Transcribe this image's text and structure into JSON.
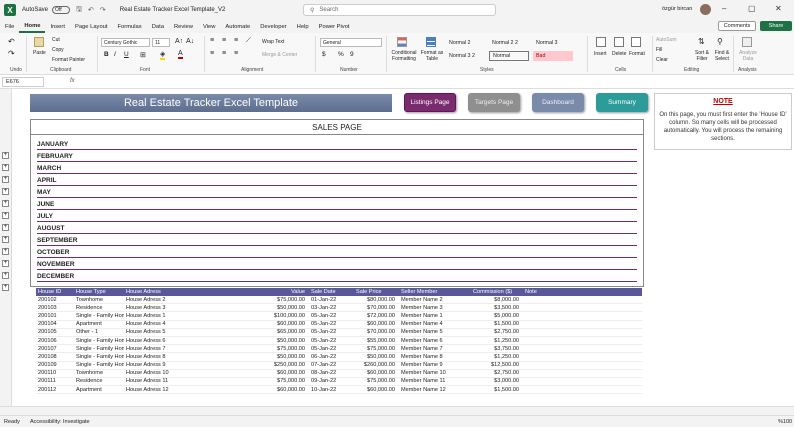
{
  "titlebar": {
    "autosave": "AutoSave",
    "toggle": "Off",
    "doc_title": "Real Estate Tracker Excel Template_V2",
    "search_placeholder": "Search",
    "user": "özgür bircan"
  },
  "menu": [
    "File",
    "Home",
    "Insert",
    "Page Layout",
    "Formulas",
    "Data",
    "Review",
    "View",
    "Automate",
    "Developer",
    "Help",
    "Power Pivot"
  ],
  "comments": "Comments",
  "share": "Share",
  "ribbon": {
    "paste": "Paste",
    "cut": "Cut",
    "copy": "Copy",
    "format_painter": "Format Painter",
    "font_name": "Century Gothic",
    "font_size": "11",
    "wrap_text": "Wrap Text",
    "merge_center": "Merge & Center",
    "number_format": "General",
    "conditional_formatting": "Conditional Formatting",
    "format_as_table": "Format as Table",
    "styles": [
      "Normal 2",
      "Normal 2 2",
      "Normal 3",
      "Normal 3 2",
      "Normal",
      "Bad"
    ],
    "insert": "Insert",
    "delete": "Delete",
    "format": "Format",
    "autosum": "AutoSum",
    "fill": "Fill",
    "clear": "Clear",
    "sort_filter": "Sort & Filter",
    "find_select": "Find & Select",
    "analyze_data": "Analyze Data",
    "groups": [
      "Undo",
      "Clipboard",
      "Font",
      "Alignment",
      "Number",
      "Styles",
      "Cells",
      "Editing",
      "Analysis"
    ]
  },
  "namebox": "E676",
  "fx": "fx",
  "header_title": "Real Estate Tracker Excel Template",
  "nav": {
    "listings": "Listings Page",
    "targets": "Targets Page",
    "dashboard": "Dashboard",
    "summary": "Summary"
  },
  "note": {
    "title": "NOTE",
    "body": "On this page, you must first enter the 'House ID' column. So many cells will be processed automatically. You will process the remaining sections."
  },
  "sales_title": "SALES PAGE",
  "months": [
    "JANUARY",
    "FEBRUARY",
    "MARCH",
    "APRIL",
    "MAY",
    "JUNE",
    "JULY",
    "AUGUST",
    "SEPTEMBER",
    "OCTOBER",
    "NOVEMBER",
    "DECEMBER"
  ],
  "table": {
    "headers": [
      "House ID",
      "House Type",
      "House Adress",
      "Value",
      "Sale Date",
      "Sale Price",
      "Seller Member",
      "Commission ($)",
      "Note"
    ],
    "rows": [
      [
        "200102",
        "Townhome",
        "House Adress 2",
        "$75,000.00",
        "01-Jan-22",
        "$80,000.00",
        "Member Name 2",
        "$8,000.00",
        ""
      ],
      [
        "200103",
        "Residence",
        "House Adress 3",
        "$50,000.00",
        "03-Jan-22",
        "$70,000.00",
        "Member Name 3",
        "$3,500.00",
        ""
      ],
      [
        "200101",
        "Single - Family Home",
        "House Adress 1",
        "$100,000.00",
        "05-Jan-22",
        "$72,000.00",
        "Member Name 1",
        "$5,000.00",
        ""
      ],
      [
        "200104",
        "Apartment",
        "House Adress 4",
        "$60,000.00",
        "05-Jan-22",
        "$60,000.00",
        "Member Name 4",
        "$1,500.00",
        ""
      ],
      [
        "200105",
        "Other - 1",
        "House Adress 5",
        "$65,000.00",
        "05-Jan-22",
        "$70,000.00",
        "Member Name 5",
        "$2,750.00",
        ""
      ],
      [
        "200106",
        "Single - Family Home",
        "House Adress 6",
        "$50,000.00",
        "05-Jan-22",
        "$55,000.00",
        "Member Name 6",
        "$1,250.00",
        ""
      ],
      [
        "200107",
        "Single - Family Home",
        "House Adress 7",
        "$75,000.00",
        "05-Jan-22",
        "$75,000.00",
        "Member Name 7",
        "$3,750.00",
        ""
      ],
      [
        "200108",
        "Single - Family Home",
        "House Adress 8",
        "$50,000.00",
        "06-Jan-22",
        "$50,000.00",
        "Member Name 8",
        "$1,250.00",
        ""
      ],
      [
        "200109",
        "Single - Family Home",
        "House Adress 9",
        "$250,000.00",
        "07-Jan-22",
        "$260,000.00",
        "Member Name 9",
        "$12,500.00",
        ""
      ],
      [
        "200110",
        "Townhome",
        "House Adress 10",
        "$60,000.00",
        "08-Jan-22",
        "$60,000.00",
        "Member Name 10",
        "$2,750.00",
        ""
      ],
      [
        "200111",
        "Residence",
        "House Adress 11",
        "$75,000.00",
        "09-Jan-22",
        "$75,000.00",
        "Member Name 11",
        "$3,000.00",
        ""
      ],
      [
        "200112",
        "Apartment",
        "House Adress 12",
        "$60,000.00",
        "10-Jan-22",
        "$60,000.00",
        "Member Name 12",
        "$1,500.00",
        ""
      ]
    ]
  },
  "status": {
    "ready": "Ready",
    "accessibility": "Accessibility: Investigate",
    "zoom": "%100"
  },
  "colors": {
    "excel_green": "#1e7145",
    "listings": "#7a2a6e",
    "targets": "#8f8f8f",
    "dashboard": "#7a8aa9",
    "summary": "#2e9b9b",
    "table_header": "#5a5899",
    "month_line": "#6b2d75"
  }
}
